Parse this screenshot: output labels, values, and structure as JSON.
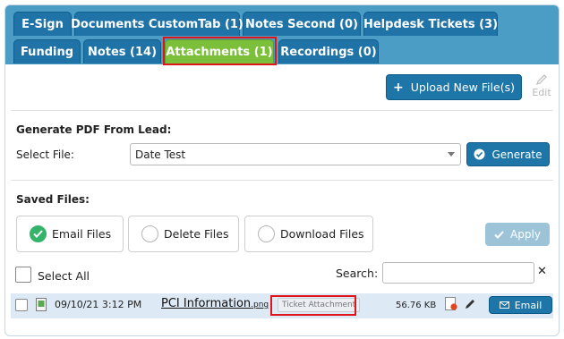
{
  "tabs_row1": [
    {
      "label": "E-Sign"
    },
    {
      "label": "Documents CustomTab (1)"
    },
    {
      "label": "Notes Second (0)"
    },
    {
      "label": "Helpdesk Tickets (3)"
    }
  ],
  "tabs_row2": [
    {
      "label": "Funding"
    },
    {
      "label": "Notes (14)"
    },
    {
      "label": "Attachments (1)",
      "active": true
    },
    {
      "label": "Recordings (0)"
    }
  ],
  "toolbar": {
    "upload_label": "Upload New File(s)",
    "edit_label": "Edit"
  },
  "generate": {
    "heading": "Generate PDF From Lead:",
    "select_label": "Select File:",
    "selected_value": "Date Test",
    "button_label": "Generate"
  },
  "saved": {
    "heading": "Saved Files:",
    "options": [
      {
        "label": "Email Files",
        "selected": true
      },
      {
        "label": "Delete Files",
        "selected": false
      },
      {
        "label": "Download Files",
        "selected": false
      }
    ],
    "apply_label": "Apply"
  },
  "list": {
    "select_all_label": "Select All",
    "search_label": "Search:",
    "search_value": "",
    "close_glyph": "✕"
  },
  "files": [
    {
      "date": "09/10/21 3:12 PM",
      "name": "PCI Information",
      "ext": ".png",
      "tag": "Ticket Attachment",
      "size": "56.76 KB",
      "email_label": "Email"
    }
  ],
  "colors": {
    "tab_blue": "#1f73a6",
    "tab_active": "#7bbf3a",
    "tabbar_bg": "#4b9dc6",
    "highlight": "#e0151b",
    "button_blue": "#1d75a8",
    "selected_green": "#34b36a",
    "row_bg": "#dde9f4"
  },
  "icons": [
    "plus-icon",
    "pencil-icon",
    "check-circle-icon",
    "chevron-down-icon",
    "checkmark-icon",
    "close-icon",
    "file-image-icon",
    "pdf-icon",
    "envelope-icon"
  ]
}
